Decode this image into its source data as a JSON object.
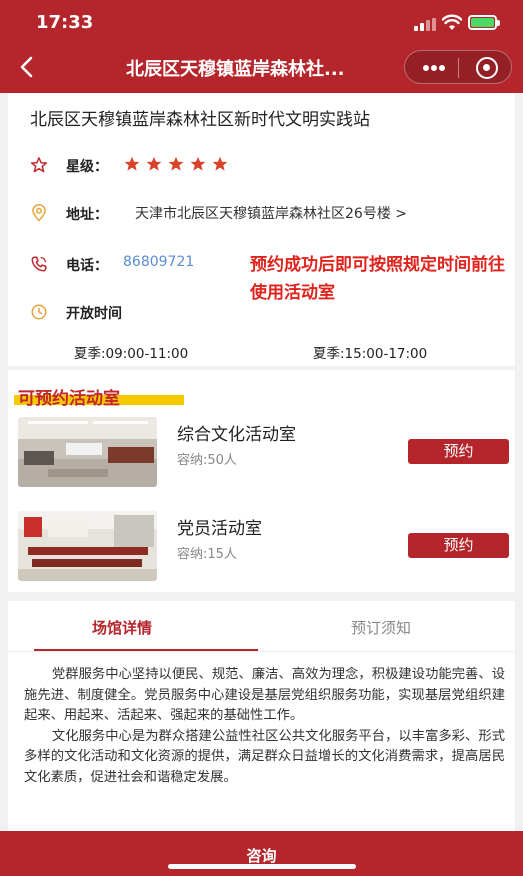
{
  "status_bar": {
    "time": "17:33"
  },
  "nav": {
    "title": "北辰区天穆镇蓝岸森林社..."
  },
  "venue": {
    "name": "北辰区天穆镇蓝岸森林社区新时代文明实践站",
    "rating_label": "星级：",
    "rating": 5,
    "rating_max": 5,
    "address_label": "地址：",
    "address": "天津市北辰区天穆镇蓝岸森林社区26号楼 >",
    "phone_label": "电话：",
    "phone": "86809721",
    "note": "预约成功后即可按照规定时间前往使用活动室",
    "hours_label": "开放时间",
    "hours": [
      "夏季:09:00-11:00",
      "夏季:15:00-17:00"
    ]
  },
  "rooms": {
    "heading": "可预约活动室",
    "items": [
      {
        "name": "综合文化活动室",
        "capacity": "容纳:50人",
        "action": "预约"
      },
      {
        "name": "党员活动室",
        "capacity": "容纳:15人",
        "action": "预约"
      }
    ]
  },
  "detail": {
    "tabs": [
      "场馆详情",
      "预订须知"
    ],
    "paragraphs": [
      "党群服务中心坚持以便民、规范、廉洁、高效为理念，积极建设功能完善、设施先进、制度健全。党员服务中心建设是基层党组织服务功能，实现基层党组织建起来、用起来、活起来、强起来的基础性工作。",
      "文化服务中心是为群众搭建公益性社区公共文化服务平台，以丰富多彩、形式多样的文化活动和文化资源的提供，满足群众日益增长的文化消费需求，提高居民文化素质，促进社会和谐稳定发展。"
    ]
  },
  "footer": {
    "consult_label": "咨询"
  },
  "colors": {
    "brand": "#b5262c",
    "accent": "#e0231c",
    "link": "#5b8cd6",
    "highlight": "#f6c800"
  }
}
